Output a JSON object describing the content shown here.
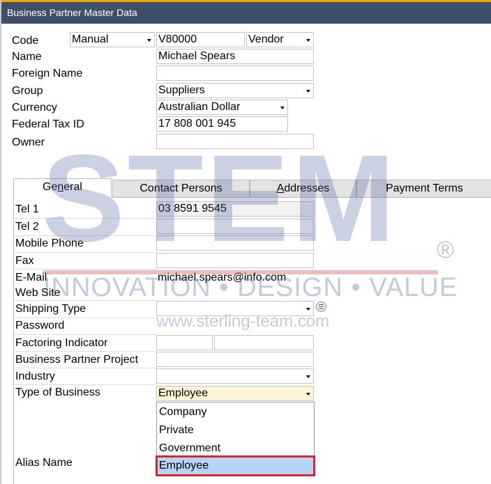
{
  "window": {
    "title": "Business Partner Master Data"
  },
  "header": {
    "code_label": "Code",
    "code_series": "Manual",
    "code_value": "V80000",
    "type_value": "Vendor",
    "name_label": "Name",
    "name_value": "Michael Spears",
    "foreign_name_label": "Foreign Name",
    "foreign_name_value": "",
    "group_label": "Group",
    "group_value": "Suppliers",
    "currency_label": "Currency",
    "currency_value": "Australian Dollar",
    "tax_id_label": "Federal Tax ID",
    "tax_id_value": "17 808 001 945",
    "owner_label": "Owner",
    "owner_value": ""
  },
  "tabs": [
    {
      "label_pre": "Ge",
      "label_u": "n",
      "label_post": "eral"
    },
    {
      "label_pre": "Contact Persons",
      "label_u": "",
      "label_post": ""
    },
    {
      "label_pre": "",
      "label_u": "A",
      "label_post": "ddresses"
    },
    {
      "label_pre": "Payment Terms",
      "label_u": "",
      "label_post": ""
    }
  ],
  "general": {
    "tel1_label": "Tel 1",
    "tel1_value": "03 8591 9545",
    "tel2_label": "Tel 2",
    "mobile_label": "Mobile Phone",
    "fax_label": "Fax",
    "email_label": "E-Mail",
    "email_value": "michael.spears@info.com",
    "website_label": "Web Site",
    "shipping_label": "Shipping Type",
    "password_label": "Password",
    "factoring_label": "Factoring Indicator",
    "project_label": "Business Partner Project",
    "industry_label": "Industry",
    "business_type_label": "Type of Business",
    "business_type_value": "Employee",
    "alias_label": "Alias Name"
  },
  "business_type_options": [
    "Company",
    "Private",
    "Government",
    "Employee"
  ],
  "watermark": {
    "brand": "STEM",
    "registered": "®",
    "tagline": "INNOVATION • DESIGN • VALUE",
    "url": "www.sterling-team.com"
  },
  "colors": {
    "titlebar": "#3f4f69",
    "accent": "#f0a800",
    "selected_field": "#fff4d6",
    "highlight_option": "#b8d4f5",
    "highlight_border": "#d9232e"
  }
}
